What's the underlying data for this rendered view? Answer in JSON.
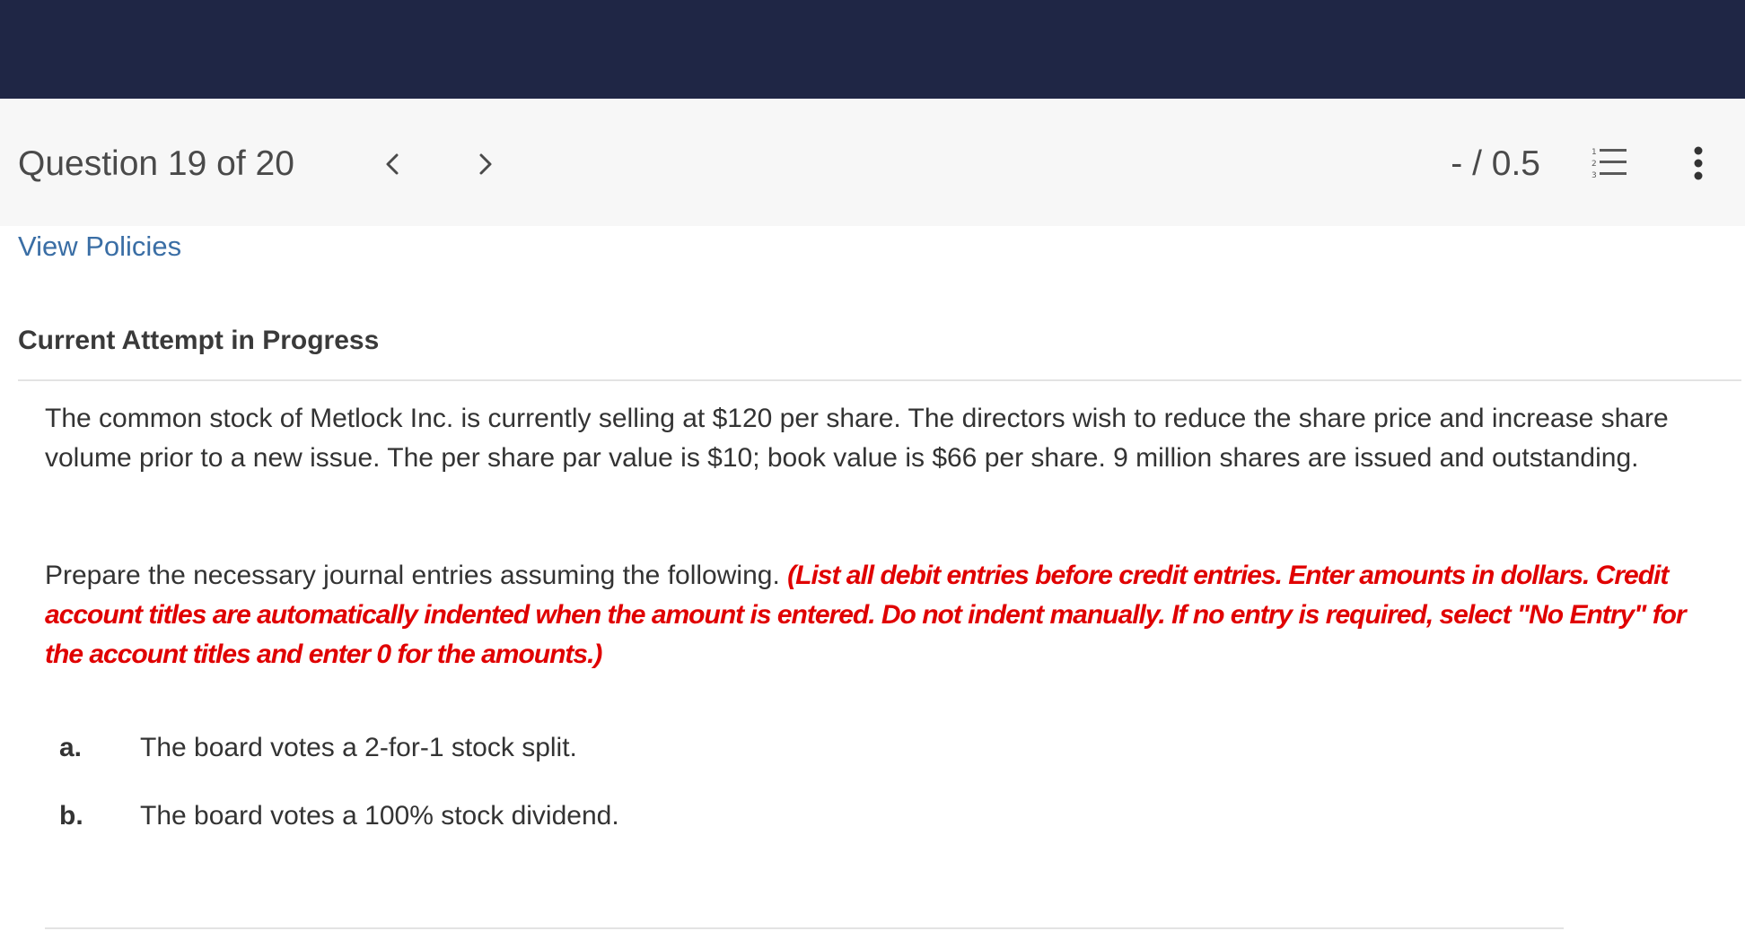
{
  "header": {
    "question_label": "Question 19 of 20",
    "score": "- / 0.5"
  },
  "icons": {
    "prev": "chevron-left-icon",
    "next": "chevron-right-icon",
    "list": "numbered-list-icon",
    "more": "more-vertical-icon"
  },
  "colors": {
    "top_bar": "#1f2645",
    "header_bg": "#f7f7f7",
    "link": "#3a6ea5",
    "emphasis": "#e00000"
  },
  "policies_link": "View Policies",
  "attempt": {
    "title": "Current Attempt in Progress"
  },
  "question": {
    "text": "The common stock of Metlock Inc. is currently selling at $120 per share. The directors wish to reduce the share price and increase share volume prior to a new issue. The per share par value is $10; book value is $66 per share. 9 million shares are issued and outstanding.",
    "instruction_prefix": "Prepare the necessary journal entries assuming the following.",
    "instruction_emphasis": "(List all debit entries before credit entries. Enter amounts in dollars. Credit account titles are automatically indented when the amount is entered. Do not indent manually. If no entry is required, select \"No Entry\" for the account titles and enter 0 for the amounts.)",
    "parts": [
      {
        "label": "a.",
        "text": "The board votes a 2-for-1 stock split."
      },
      {
        "label": "b.",
        "text": "The board votes a 100% stock dividend."
      }
    ]
  }
}
